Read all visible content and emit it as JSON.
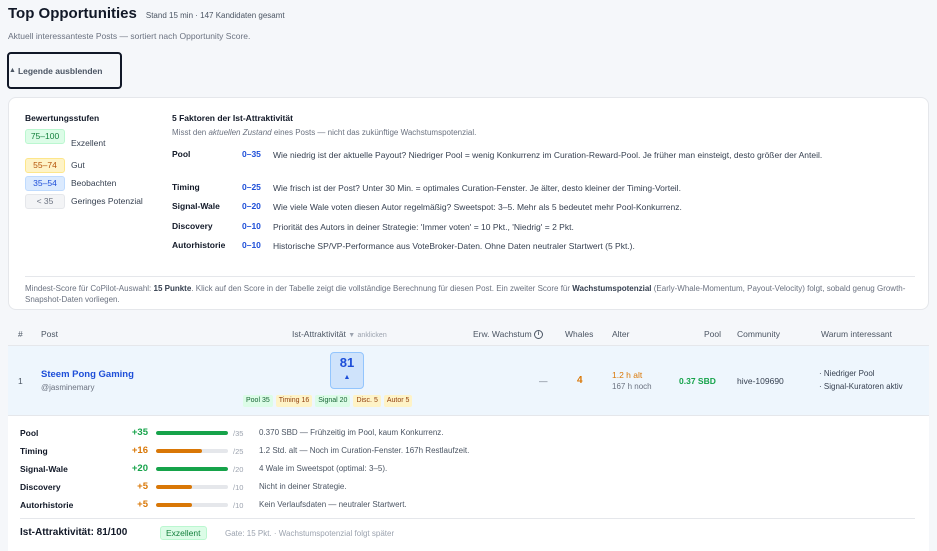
{
  "header": {
    "title": "Top Opportunities",
    "stand": "Stand 15 min · 147 Kandidaten gesamt",
    "subtitle": "Aktuell interessanteste Posts — sortiert nach Opportunity Score.",
    "legend_toggle": "Legende ausblenden"
  },
  "legend": {
    "levels_title": "Bewertungsstufen",
    "levels": [
      {
        "range": "75–100",
        "label": "Exzellent"
      },
      {
        "range": "55–74",
        "label": "Gut"
      },
      {
        "range": "35–54",
        "label": "Beobachten"
      },
      {
        "range": "< 35",
        "label": "Geringes Potenzial"
      }
    ],
    "factors_title": "5 Faktoren der Ist-Attraktivität",
    "factors_sub_pre": "Misst den ",
    "factors_sub_em": "aktuellen Zustand",
    "factors_sub_post": " eines Posts — nicht das zukünftige Wachstumspotenzial.",
    "factors": [
      {
        "name": "Pool",
        "range": "0–35",
        "desc": "Wie niedrig ist der aktuelle Payout? Niedriger Pool = wenig Konkurrenz im Curation-Reward-Pool. Je früher man einsteigt, desto größer der Anteil."
      },
      {
        "name": "Timing",
        "range": "0–25",
        "desc": "Wie frisch ist der Post? Unter 30 Min. = optimales Curation-Fenster. Je älter, desto kleiner der Timing-Vorteil."
      },
      {
        "name": "Signal-Wale",
        "range": "0–20",
        "desc": "Wie viele Wale voten diesen Autor regelmäßig? Sweetspot: 3–5. Mehr als 5 bedeutet mehr Pool-Konkurrenz."
      },
      {
        "name": "Discovery",
        "range": "0–10",
        "desc": "Priorität des Autors in deiner Strategie: 'Immer voten' = 10 Pkt., 'Niedrig' = 2 Pkt."
      },
      {
        "name": "Autorhistorie",
        "range": "0–10",
        "desc": "Historische SP/VP-Performance aus VoteBroker-Daten. Ohne Daten neutraler Startwert (5 Pkt.)."
      }
    ],
    "note_1": "Mindest-Score für CoPilot-Auswahl: ",
    "note_bold_1": "15 Punkte",
    "note_2": ". Klick auf den Score in der Tabelle zeigt die vollständige Berechnung für diesen Post. Ein zweiter Score für ",
    "note_bold_2": "Wachstumspotenzial",
    "note_3": " (Early-Whale-Momentum, Payout-Velocity) folgt, sobald genug Growth-Snapshot-Daten vorliegen."
  },
  "table": {
    "headers": {
      "num": "#",
      "post": "Post",
      "ist": "Ist-Attraktivität",
      "sort": "▼",
      "klicken": "anklicken",
      "wachstum": "Erw. Wachstum",
      "whales": "Whales",
      "alter": "Alter",
      "pool": "Pool",
      "community": "Community",
      "warum": "Warum interessant"
    },
    "rows": [
      {
        "num": "1",
        "title": "Steem Pong Gaming",
        "author": "@jasminemary",
        "score": "81",
        "chips": [
          "Pool 35",
          "Timing 16",
          "Signal 20",
          "Disc. 5",
          "Autor 5"
        ],
        "wachstum": "—",
        "whales": "4",
        "alter": "1.2 h alt",
        "alter_sub": "167 h noch",
        "pool": "0.37 SBD",
        "community": "hive-109690",
        "warum": [
          "· Niedriger Pool",
          "· Signal-Kuratoren aktiv"
        ]
      }
    ]
  },
  "details": {
    "rows": [
      {
        "name": "Pool",
        "value": "+35",
        "max": "/35",
        "fraction": 1.0,
        "color": "#16a34a",
        "desc": "0.370 SBD — Frühzeitig im Pool, kaum Konkurrenz."
      },
      {
        "name": "Timing",
        "value": "+16",
        "max": "/25",
        "fraction": 0.64,
        "color": "#d97706",
        "desc": "1.2 Std. alt — Noch im Curation-Fenster. 167h Restlaufzeit."
      },
      {
        "name": "Signal-Wale",
        "value": "+20",
        "max": "/20",
        "fraction": 1.0,
        "color": "#16a34a",
        "desc": "4 Wale im Sweetspot (optimal: 3–5)."
      },
      {
        "name": "Discovery",
        "value": "+5",
        "max": "/10",
        "fraction": 0.5,
        "color": "#d97706",
        "desc": "Nicht in deiner Strategie."
      },
      {
        "name": "Autorhistorie",
        "value": "+5",
        "max": "/10",
        "fraction": 0.5,
        "color": "#d97706",
        "desc": "Kein Verlaufsdaten — neutraler Startwert."
      }
    ],
    "summary": "Ist-Attraktivität: 81/100",
    "badge": "Exzellent",
    "gate": "Gate: 15 Pkt. · Wachstumspotenzial folgt später"
  }
}
